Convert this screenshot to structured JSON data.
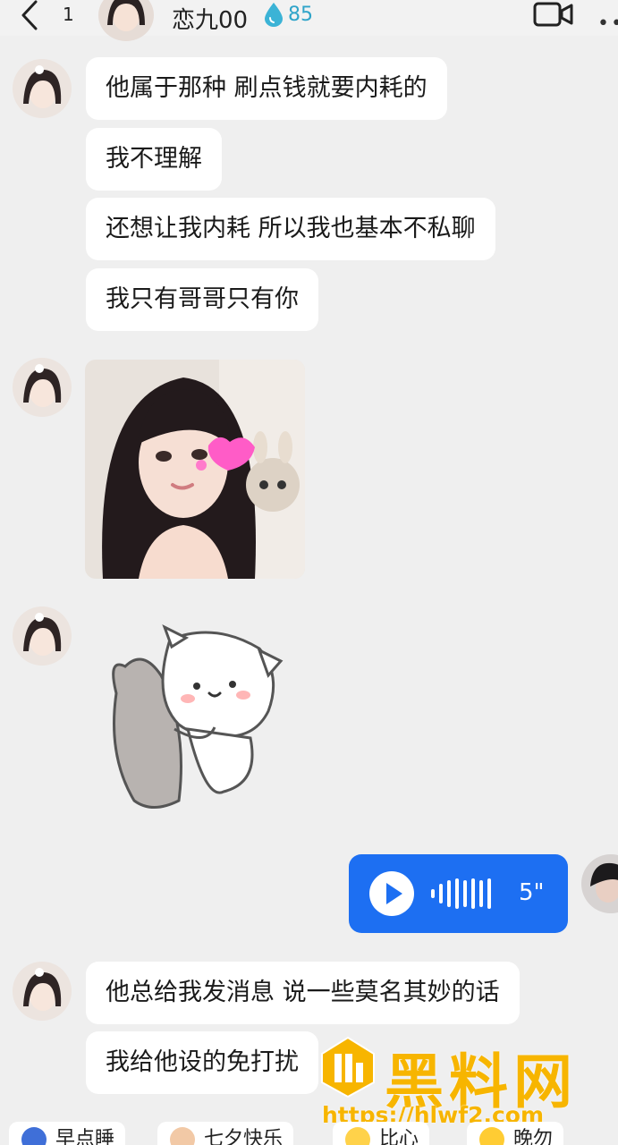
{
  "header": {
    "unread_count": "1",
    "contact_name": "恋九00",
    "intimacy_value": "85"
  },
  "messages": [
    {
      "text": "他属于那种 刷点钱就要内耗的"
    },
    {
      "text": "我不理解"
    },
    {
      "text": "还想让我内耗 所以我也基本不私聊"
    },
    {
      "text": "我只有哥哥只有你"
    },
    {
      "text": "他总给我发消息 说一些莫名其妙的话"
    },
    {
      "text": "我给他设的免打扰"
    }
  ],
  "voice_message": {
    "duration": "5\""
  },
  "watermark": {
    "title": "黑料网",
    "url": "https://hlwf2.com"
  },
  "quick_replies": [
    {
      "label": "早点睡"
    },
    {
      "label": "七夕快乐"
    },
    {
      "label": "比心"
    },
    {
      "label": "晚勿"
    }
  ],
  "colors": {
    "background": "#efefef",
    "voice_bubble": "#1d6ff2",
    "intimacy": "#2fa4c9",
    "watermark": "#f7b500"
  }
}
